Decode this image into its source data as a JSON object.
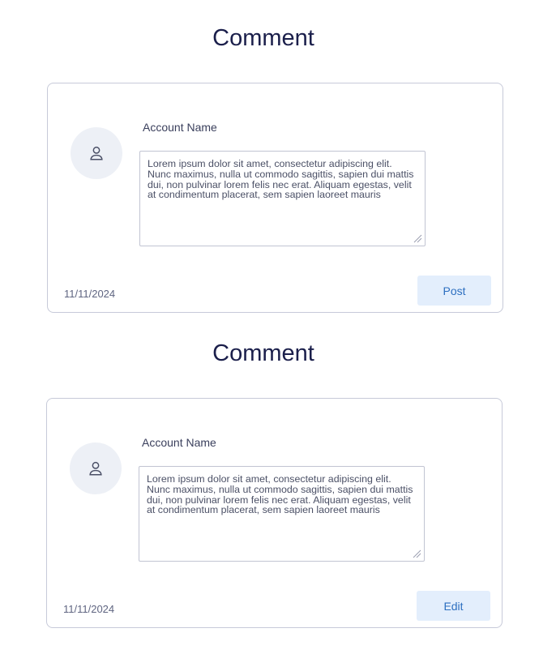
{
  "comments": [
    {
      "title": "Comment",
      "account_name": "Account Name",
      "avatar_icon": "user-icon",
      "body": "Lorem ipsum dolor sit amet, consectetur adipiscing elit. Nunc maximus, nulla ut commodo sagittis, sapien dui mattis dui, non pulvinar lorem felis nec erat. Aliquam egestas, velit at condimentum placerat, sem sapien laoreet mauris",
      "date": "11/11/2024",
      "action_label": "Post"
    },
    {
      "title": "Comment",
      "account_name": "Account Name",
      "avatar_icon": "user-icon",
      "body": "Lorem ipsum dolor sit amet, consectetur adipiscing elit. Nunc maximus, nulla ut commodo sagittis, sapien dui mattis dui, non pulvinar lorem felis nec erat. Aliquam egestas, velit at condimentum placerat, sem sapien laoreet mauris",
      "date": "11/11/2024",
      "action_label": "Edit"
    }
  ],
  "colors": {
    "title": "#1b1f4b",
    "card_border": "#c7cad9",
    "avatar_bg": "#edf0f6",
    "button_bg": "#e3eefc",
    "button_text": "#2d6fc0"
  }
}
